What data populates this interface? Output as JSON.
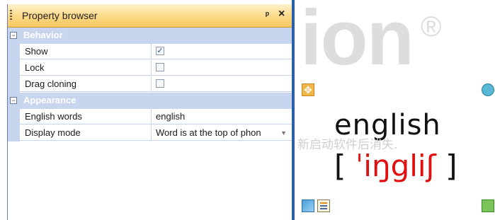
{
  "panel": {
    "title": "Property browser",
    "pin_glyph": "$",
    "close_glyph": "×"
  },
  "categories": [
    {
      "label": "Behavior",
      "collapsed": false,
      "properties": [
        {
          "name": "Show",
          "type": "checkbox",
          "checked": true
        },
        {
          "name": "Lock",
          "type": "checkbox",
          "checked": false
        },
        {
          "name": "Drag cloning",
          "type": "checkbox",
          "checked": false
        }
      ]
    },
    {
      "label": "Appearance",
      "collapsed": false,
      "properties": [
        {
          "name": "English words",
          "type": "text",
          "value": "english"
        },
        {
          "name": "Display mode",
          "type": "dropdown",
          "value": "Word is at the top of phon"
        }
      ]
    }
  ],
  "preview": {
    "background_text": "ion",
    "background_mark": "®",
    "word": "english",
    "hint": "新启动软件后消失.",
    "phonetic_open": "[",
    "phonetic": "ˈiŋgliʃ",
    "phonetic_close": "]"
  },
  "colors": {
    "category_bg": "#c7d6ee",
    "titlebar": "#fbd886",
    "divider": "#2b5fa8",
    "phonetic": "#e01010"
  },
  "icons": [
    "pin-icon",
    "close-icon",
    "move-icon",
    "rotate-icon",
    "picture-edit-icon",
    "notes-edit-icon",
    "resize-icon"
  ]
}
